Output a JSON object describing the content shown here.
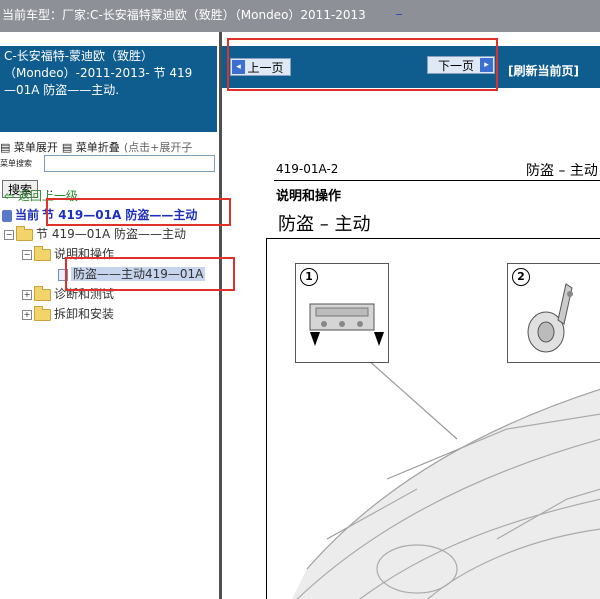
{
  "topbar": {
    "label": "当前车型：",
    "vehicle": "厂家:C-长安福特蒙迪欧（致胜）（Mondeo）2011-2013"
  },
  "left": {
    "header": {
      "line1": "C-长安福特-蒙迪欧（致胜）",
      "line2": "（Mondeo）-2011-2013- 节 419",
      "line3": "—01A 防盗——主动."
    },
    "expand_label": "菜单展开",
    "collapse_label": "菜单折叠",
    "collapse_hint": "(点击+展开子",
    "search_label": "菜单搜索",
    "search_value": "",
    "search_button": "搜索",
    "search_dots": ".."
  },
  "tree": {
    "back": "返回上一级",
    "current_prefix": "当前",
    "current": "节 419—01A 防盗——主动",
    "root": "节 419—01A 防盗——主动",
    "items": [
      {
        "label": "说明和操作"
      },
      {
        "label": "防盗——主动419—01A"
      },
      {
        "label": "诊断和测试"
      },
      {
        "label": "拆卸和安装"
      }
    ]
  },
  "nav": {
    "prev": "上一页",
    "next": "下一页",
    "refresh": "[刷新当前页]"
  },
  "document": {
    "code": "419-01A-2",
    "header_right": "防盗 – 主动",
    "subtitle": "说明和操作",
    "title": "防盗 – 主动",
    "callouts": [
      "1",
      "2"
    ]
  },
  "colors": {
    "header_bg": "#0f5c8f",
    "highlight": "#e0302a",
    "topbar_bg": "#8e9098"
  }
}
